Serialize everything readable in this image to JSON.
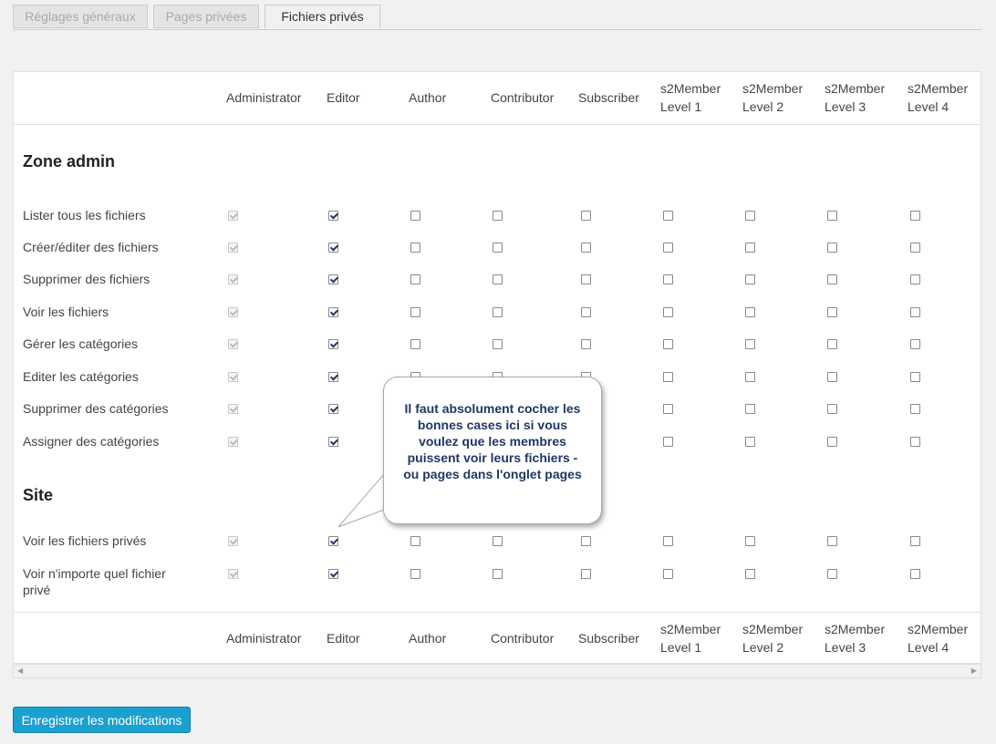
{
  "tabs": [
    "Réglages généraux",
    "Pages privées",
    "Fichiers privés"
  ],
  "active_tab": 2,
  "columns": [
    {
      "line1": "Administrator",
      "line2": ""
    },
    {
      "line1": "Editor",
      "line2": ""
    },
    {
      "line1": "Author",
      "line2": ""
    },
    {
      "line1": "Contributor",
      "line2": ""
    },
    {
      "line1": "Subscriber",
      "line2": ""
    },
    {
      "line1": "s2Member",
      "line2": "Level 1"
    },
    {
      "line1": "s2Member",
      "line2": "Level 2"
    },
    {
      "line1": "s2Member",
      "line2": "Level 3"
    },
    {
      "line1": "s2Member",
      "line2": "Level 4"
    }
  ],
  "sections": [
    {
      "title": "Zone admin",
      "rows": [
        {
          "label": "Lister tous les fichiers",
          "checked": [
            true,
            true,
            false,
            false,
            false,
            false,
            false,
            false,
            false
          ]
        },
        {
          "label": "Créer/éditer des fichiers",
          "checked": [
            true,
            true,
            false,
            false,
            false,
            false,
            false,
            false,
            false
          ]
        },
        {
          "label": "Supprimer des fichiers",
          "checked": [
            true,
            true,
            false,
            false,
            false,
            false,
            false,
            false,
            false
          ]
        },
        {
          "label": "Voir les fichiers",
          "checked": [
            true,
            true,
            false,
            false,
            false,
            false,
            false,
            false,
            false
          ]
        },
        {
          "label": "Gérer les catégories",
          "checked": [
            true,
            true,
            false,
            false,
            false,
            false,
            false,
            false,
            false
          ]
        },
        {
          "label": "Editer les catégories",
          "checked": [
            true,
            true,
            false,
            false,
            false,
            false,
            false,
            false,
            false
          ]
        },
        {
          "label": "Supprimer des catégories",
          "checked": [
            true,
            true,
            false,
            false,
            false,
            false,
            false,
            false,
            false
          ]
        },
        {
          "label": "Assigner des catégories",
          "checked": [
            true,
            true,
            false,
            false,
            false,
            false,
            false,
            false,
            false
          ]
        }
      ]
    },
    {
      "title": "Site",
      "rows": [
        {
          "label": "Voir les fichiers privés",
          "checked": [
            true,
            true,
            false,
            false,
            false,
            false,
            false,
            false,
            false
          ]
        },
        {
          "label": "Voir n'importe quel fichier privé",
          "checked": [
            true,
            true,
            false,
            false,
            false,
            false,
            false,
            false,
            false
          ]
        }
      ]
    }
  ],
  "callout_text": "Il faut absolument cocher les bonnes cases ici si vous voulez que les membres puissent voir leurs fichiers - ou pages dans l'onglet pages",
  "save_label": "Enregistrer les modifications",
  "colors": {
    "accent": "#1ba1cf",
    "callout_text": "#1f3864"
  }
}
